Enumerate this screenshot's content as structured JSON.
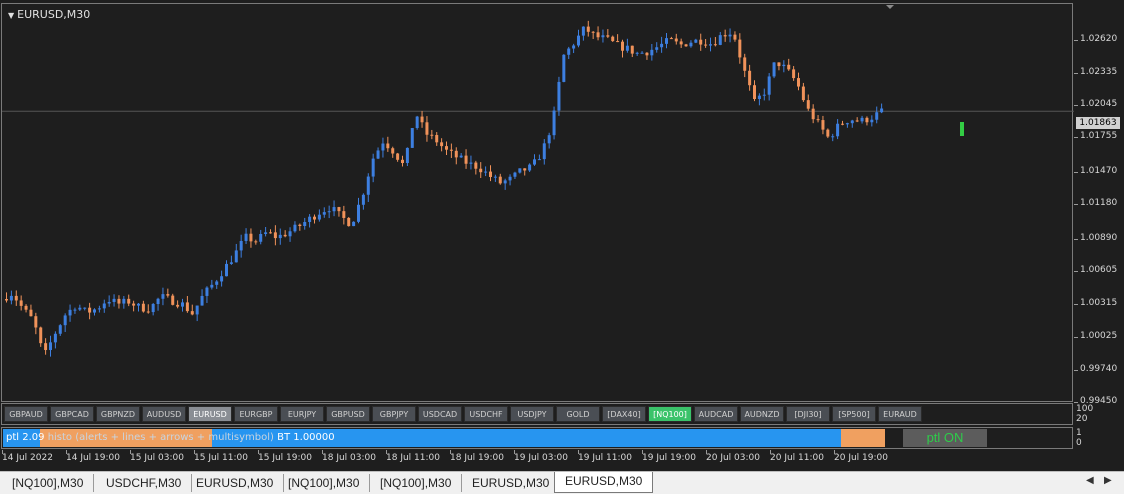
{
  "chart": {
    "title": "EURUSD,M30",
    "current_price_label": "1.01863",
    "price_ticks": [
      "1.02620",
      "1.02335",
      "1.02045",
      "1.01755",
      "1.01470",
      "1.01180",
      "1.00890",
      "1.00605",
      "1.00315",
      "1.00025",
      "0.99740",
      "0.99450"
    ],
    "time_ticks": [
      "14 Jul 2022",
      "14 Jul 19:00",
      "15 Jul 03:00",
      "15 Jul 11:00",
      "15 Jul 19:00",
      "18 Jul 03:00",
      "18 Jul 11:00",
      "18 Jul 19:00",
      "19 Jul 03:00",
      "19 Jul 11:00",
      "19 Jul 19:00",
      "20 Jul 03:00",
      "20 Jul 11:00",
      "20 Jul 19:00"
    ],
    "colors": {
      "bull": "#3d7fe0",
      "bear": "#f0925a",
      "background": "#1e1e1e",
      "price_line": "#555555",
      "signal": "#33cc44"
    }
  },
  "chart_data": {
    "type": "candlestick",
    "symbol": "EURUSD",
    "timeframe": "M30",
    "ylim": [
      0.9945,
      1.0275
    ],
    "close_path": [
      1.0031,
      1.0036,
      1.0023,
      1.0013,
      0.9983,
      1.0002,
      1.0018,
      1.0026,
      1.002,
      1.0023,
      1.0031,
      1.0027,
      1.0029,
      1.0024,
      1.0023,
      1.0033,
      1.003,
      1.0027,
      1.0019,
      1.0034,
      1.0044,
      1.0056,
      1.0068,
      1.0082,
      1.0079,
      1.0086,
      1.0082,
      1.0086,
      1.0091,
      1.0097,
      1.0103,
      1.0107,
      1.0099,
      1.0093,
      1.0116,
      1.0147,
      1.0162,
      1.0153,
      1.014,
      1.0186,
      1.0168,
      1.0162,
      1.0153,
      1.0148,
      1.0143,
      1.014,
      1.0133,
      1.0127,
      1.013,
      1.0137,
      1.014,
      1.0153,
      1.0178,
      1.0232,
      1.0243,
      1.0255,
      1.0248,
      1.0246,
      1.0241,
      1.0238,
      1.0234,
      1.0236,
      1.024,
      1.0245,
      1.0241,
      1.0244,
      1.0245,
      1.0242,
      1.025,
      1.0252,
      1.0221,
      1.0193,
      1.0203,
      1.0228,
      1.0221,
      1.021,
      1.0188,
      1.0176,
      1.0164,
      1.0175,
      1.018,
      1.0178,
      1.0181,
      1.0186
    ],
    "last_price": 1.01863
  },
  "symbols": [
    {
      "label": "GBPAUD",
      "state": "normal"
    },
    {
      "label": "GBPCAD",
      "state": "normal"
    },
    {
      "label": "GBPNZD",
      "state": "normal"
    },
    {
      "label": "AUDUSD",
      "state": "normal"
    },
    {
      "label": "EURUSD",
      "state": "active"
    },
    {
      "label": "EURGBP",
      "state": "normal"
    },
    {
      "label": "EURJPY",
      "state": "normal"
    },
    {
      "label": "GBPUSD",
      "state": "normal"
    },
    {
      "label": "GBPJPY",
      "state": "normal"
    },
    {
      "label": "USDCAD",
      "state": "normal"
    },
    {
      "label": "USDCHF",
      "state": "normal"
    },
    {
      "label": "USDJPY",
      "state": "normal"
    },
    {
      "label": "GOLD",
      "state": "normal"
    },
    {
      "label": "[DAX40]",
      "state": "normal"
    },
    {
      "label": "[NQ100]",
      "state": "green"
    },
    {
      "label": "AUDCAD",
      "state": "normal"
    },
    {
      "label": "AUDNZD",
      "state": "normal"
    },
    {
      "label": "[DJI30]",
      "state": "normal"
    },
    {
      "label": "[SP500]",
      "state": "normal"
    },
    {
      "label": "EURAUD",
      "state": "normal"
    }
  ],
  "symbol_axis": {
    "top": "100",
    "bottom": "20"
  },
  "indicator": {
    "text_main": "ptl 2.09",
    "text_faint": "histo (alerts + lines + arrows + multisymbol)",
    "text_tail": "BT 1.00000",
    "button_label": "ptl ON",
    "axis_top": "1",
    "axis_bottom": "0"
  },
  "tabs": [
    "[NQ100],M30",
    "USDCHF,M30",
    "EURUSD,M30",
    "[NQ100],M30",
    "[NQ100],M30",
    "EURUSD,M30",
    "EURUSD,M30"
  ],
  "active_tab_index": 6
}
